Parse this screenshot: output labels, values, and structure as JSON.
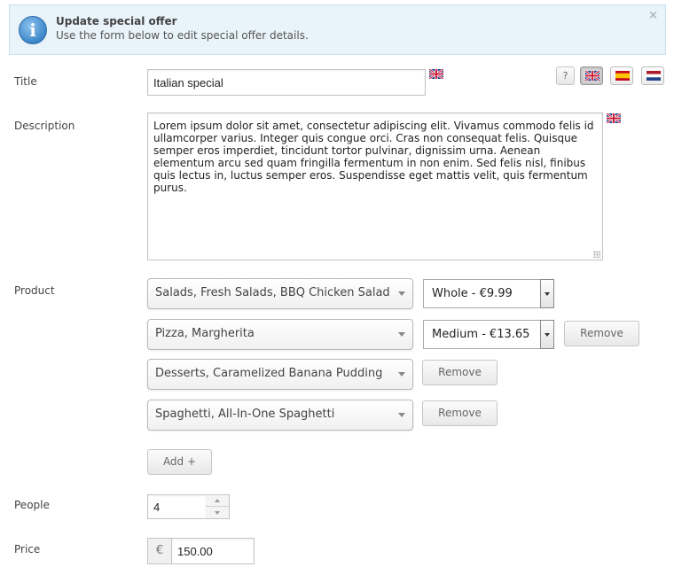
{
  "notice": {
    "title": "Update special offer",
    "subtitle": "Use the form below to edit special offer details.",
    "close": "×",
    "icon": "info-icon"
  },
  "language_bar": {
    "help": "?",
    "languages": [
      {
        "name": "uk-flag-icon",
        "active": true
      },
      {
        "name": "spain-flag-icon",
        "active": false
      },
      {
        "name": "netherlands-flag-icon",
        "active": false
      }
    ]
  },
  "form": {
    "title": {
      "label": "Title",
      "value": "Italian special"
    },
    "description": {
      "label": "Description",
      "value": "Lorem ipsum dolor sit amet, consectetur adipiscing elit. Vivamus commodo felis id ullamcorper varius. Integer quis congue orci. Cras non consequat felis. Quisque semper eros imperdiet, tincidunt tortor pulvinar, dignissim urna. Aenean elementum arcu sed quam fringilla fermentum in non enim. Sed felis nisl, finibus quis lectus in, luctus semper eros. Suspendisse eget mattis velit, quis fermentum purus."
    },
    "product": {
      "label": "Product",
      "rows": [
        {
          "product": "Salads, Fresh Salads, BBQ Chicken Salad",
          "size": "Whole - €9.99",
          "remove": ""
        },
        {
          "product": "Pizza, Margherita",
          "size": "Medium - €13.65",
          "remove": "Remove"
        },
        {
          "product": "Desserts, Caramelized Banana Pudding",
          "size": "",
          "remove": "Remove"
        },
        {
          "product": "Spaghetti, All-In-One Spaghetti",
          "size": "",
          "remove": "Remove"
        }
      ],
      "add_label": "Add +"
    },
    "people": {
      "label": "People",
      "value": "4"
    },
    "price": {
      "label": "Price",
      "currency": "€",
      "value": "150.00"
    }
  }
}
